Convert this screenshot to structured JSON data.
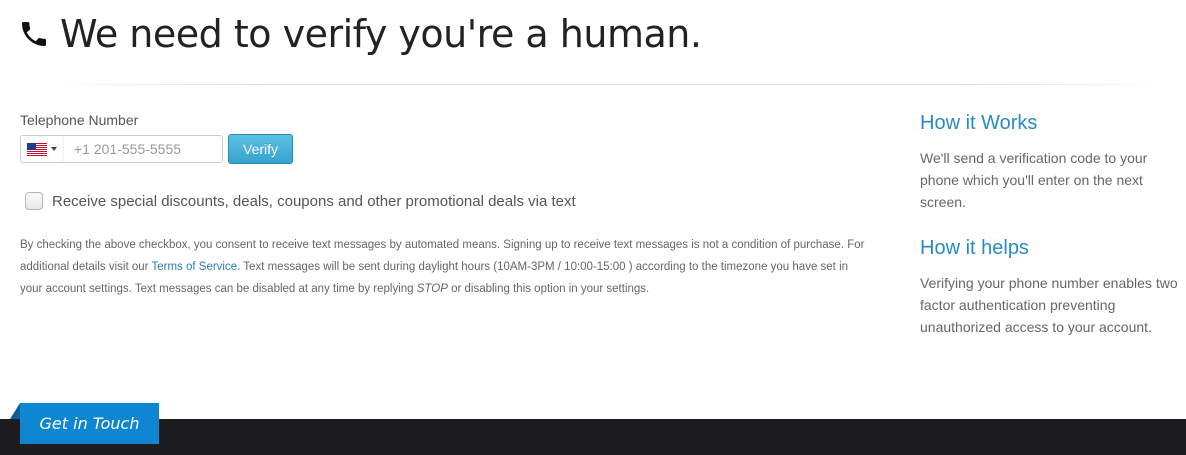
{
  "page": {
    "title": "We need to verify you're a human."
  },
  "form": {
    "phone_label": "Telephone Number",
    "country_code": "US",
    "phone_placeholder": "+1 201-555-5555",
    "phone_value": "",
    "verify_label": "Verify",
    "promo_checked": false,
    "promo_label": "Receive special discounts, deals, coupons and other promotional deals via text"
  },
  "consent": {
    "part1": "By checking the above checkbox, you consent to receive text messages by automated means. Signing up to receive text messages is not a condition of purchase. For additional details visit our ",
    "terms_link": "Terms of Service",
    "part2": ". Text messages will be sent during daylight hours (10AM-3PM / 10:00-15:00 ) according to the timezone you have set in your account settings. Text messages can be disabled at any time by replying ",
    "stop_word": "STOP",
    "part3": " or disabling this option in your settings."
  },
  "sidebar": {
    "works_heading": "How it Works",
    "works_text": "We'll send a verification code to your phone which you'll enter on the next screen.",
    "helps_heading": "How it helps",
    "helps_text": "Verifying your phone number enables two factor authentication preventing unauthorized access to your account."
  },
  "footer": {
    "get_in_touch_label": "Get in Touch"
  },
  "colors": {
    "accent": "#2a8ac7",
    "button": "#35a3cf",
    "footer_bg": "#1d1d1f",
    "tab_bg": "#0e86d2"
  },
  "icons": {
    "title": "phone-icon",
    "country": "us-flag-icon",
    "dropdown": "caret-down-icon"
  }
}
